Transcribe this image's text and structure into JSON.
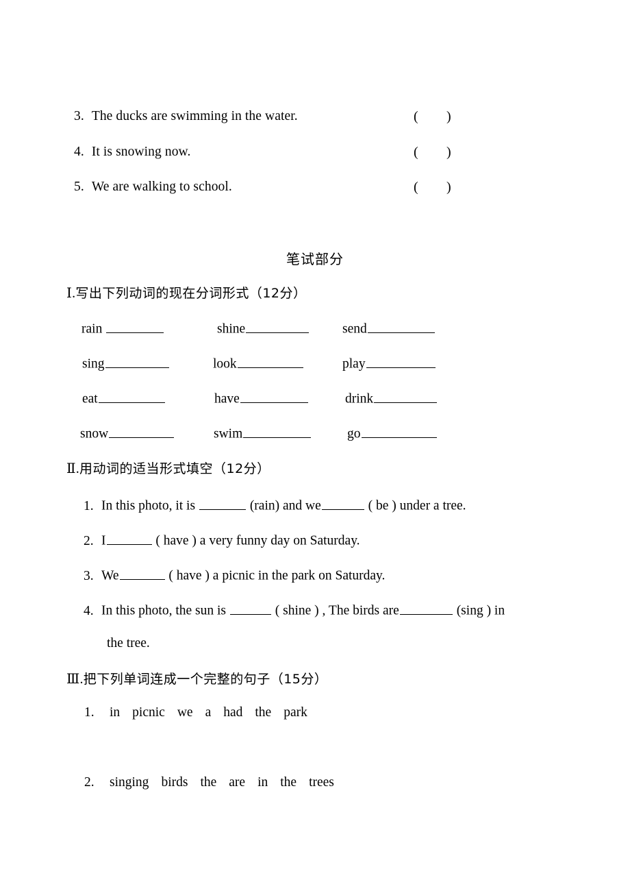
{
  "document": {
    "type": "worksheet",
    "language": "zh-CN/en",
    "background_color": "#ffffff",
    "text_color": "#000000"
  },
  "listening_leftover": {
    "items": [
      {
        "number": "3.",
        "text": "The ducks are swimming in the water.",
        "paren_open": "(",
        "paren_close": ")"
      },
      {
        "number": "4.",
        "text": "It is snowing now.",
        "paren_open": "(",
        "paren_close": ")"
      },
      {
        "number": "5.",
        "text": "We are walking to school.",
        "paren_open": "(",
        "paren_close": ")"
      }
    ]
  },
  "written_part": {
    "title": "笔试部分"
  },
  "section_1": {
    "numeral": "Ⅰ",
    "dot": ".",
    "heading": "写出下列动词的现在分词形式（12分）",
    "rows": [
      [
        {
          "verb": "rain",
          "gap": " "
        },
        {
          "verb": "shine",
          "gap": ""
        },
        {
          "verb": "send",
          "gap": ""
        }
      ],
      [
        {
          "verb": "sing",
          "gap": ""
        },
        {
          "verb": "look",
          "gap": ""
        },
        {
          "verb": "play",
          "gap": ""
        }
      ],
      [
        {
          "verb": "eat",
          "gap": ""
        },
        {
          "verb": "have",
          "gap": ""
        },
        {
          "verb": "drink",
          "gap": ""
        }
      ],
      [
        {
          "verb": "snow",
          "gap": ""
        },
        {
          "verb": "swim",
          "gap": ""
        },
        {
          "verb": "go",
          "gap": ""
        }
      ]
    ]
  },
  "section_2": {
    "numeral": "Ⅱ",
    "dot": ".",
    "heading": "用动词的适当形式填空（12分）",
    "items": [
      {
        "number": "1.",
        "parts": [
          "In this photo, it is ",
          " (rain) and we",
          " ( be ) under a tree."
        ]
      },
      {
        "number": "2.",
        "parts": [
          "I",
          " ( have ) a very funny day on Saturday."
        ]
      },
      {
        "number": "3.",
        "parts": [
          "We",
          " ( have ) a picnic in the park on Saturday."
        ]
      },
      {
        "number": "4.",
        "parts": [
          "In this photo, the sun is ",
          " ( shine ) , The birds are",
          " (sing ) in"
        ],
        "continuation": "the tree."
      }
    ]
  },
  "section_3": {
    "numeral": "Ⅲ",
    "dot": ".",
    "heading": "把下列单词连成一个完整的句子（15分）",
    "items": [
      {
        "number": "1.",
        "words": [
          "in",
          "picnic",
          "we",
          "a",
          "had",
          "the",
          "park"
        ]
      },
      {
        "number": "2.",
        "words": [
          "singing",
          "birds",
          "the",
          "are",
          "in",
          "the",
          "trees"
        ]
      }
    ]
  }
}
